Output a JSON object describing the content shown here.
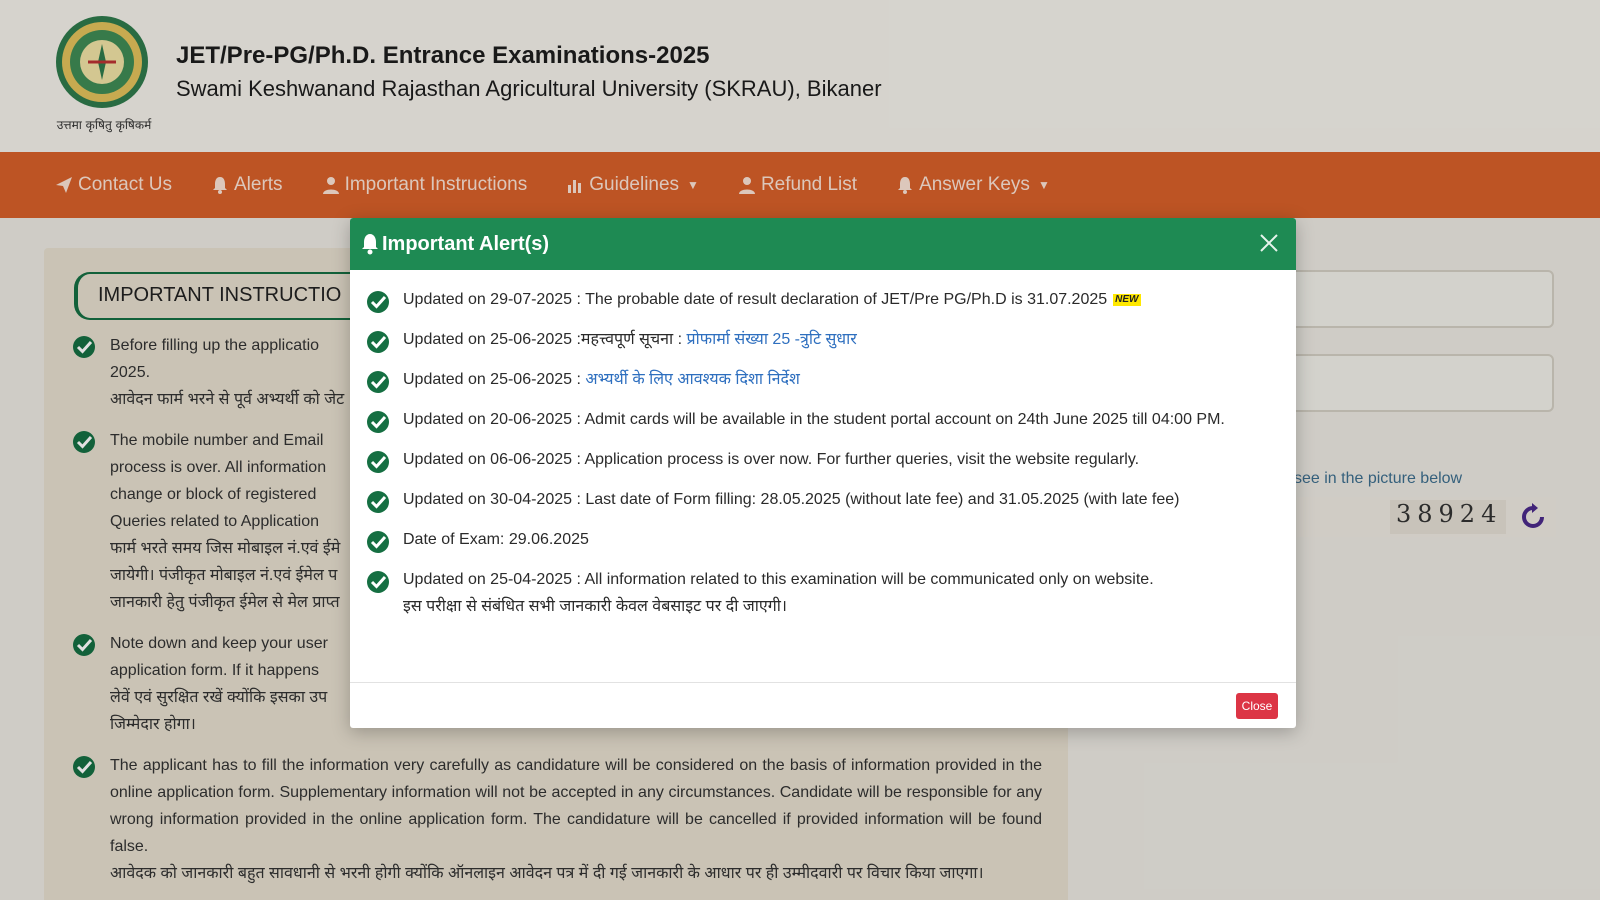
{
  "header": {
    "title": "JET/Pre-PG/Ph.D. Entrance Examinations-2025",
    "subtitle": "Swami Keshwanand Rajasthan Agricultural University (SKRAU), Bikaner",
    "logo_motto": "उत्तमा कृषितु कृषिकर्म"
  },
  "nav": {
    "items": [
      {
        "label": "Contact Us",
        "icon": "paper-plane-icon"
      },
      {
        "label": "Alerts",
        "icon": "bell-icon"
      },
      {
        "label": "Important Instructions",
        "icon": "user-icon"
      },
      {
        "label": "Guidelines",
        "icon": "bar-chart-icon",
        "dropdown": true
      },
      {
        "label": "Refund List",
        "icon": "user-icon"
      },
      {
        "label": "Answer Keys",
        "icon": "bell-icon",
        "dropdown": true
      }
    ]
  },
  "background": {
    "instructions_title": "IMPORTANT INSTRUCTIO",
    "items": [
      {
        "lines": [
          "Before filling up the applicatio",
          "2025.",
          "आवेदन फार्म भरने से पूर्व अभ्यर्थी को जेट"
        ]
      },
      {
        "lines": [
          "The mobile number and Email",
          "process is over. All information",
          "change or block of registered",
          "Queries related to Application",
          "फार्म भरते समय जिस मोबाइल नं.एवं ईमे",
          "जायेगी। पंजीकृत मोबाइल नं.एवं ईमेल प",
          "जानकारी हेतु पंजीकृत ईमेल से मेल प्राप्त"
        ]
      },
      {
        "lines": [
          "Note down and keep your user",
          "application form. If it happens",
          "लेवें एवं सुरक्षित रखें क्योंकि इसका उप",
          "जिम्मेदार होगा।"
        ]
      },
      {
        "text": "The applicant has to fill the information very carefully as candidature will be considered on the basis of information provided in the online application form. Supplementary information will not be accepted in any circumstances. Candidate will be responsible for any wrong information provided in the online application form. The candidature will be cancelled if provided information will be found false.",
        "hindi": "आवेदक को जानकारी बहुत सावधानी से भरनी होगी क्योंकि ऑनलाइन आवेदन पत्र में दी गई जानकारी के आधार पर ही उम्मीदवारी पर विचार किया जाएगा।"
      }
    ],
    "captcha_hint": "see in the picture below",
    "captcha_value": "38924"
  },
  "modal": {
    "title": "Important Alert(s)",
    "close_label": "Close",
    "new_badge": "NEW",
    "alerts": [
      {
        "text": "Updated on 29-07-2025 : The probable date of result declaration of JET/Pre PG/Ph.D is 31.07.2025"
      },
      {
        "text": "Updated on 25-06-2025 :महत्त्वपूर्ण सूचना : ",
        "link": "प्रोफार्मा संख्या 25 -त्रुटि सुधार"
      },
      {
        "text": "Updated on 25-06-2025 : ",
        "link": "अभ्यर्थी के लिए आवश्यक दिशा निर्देश"
      },
      {
        "text": "Updated on 20-06-2025 : Admit cards will be available in the student portal account on 24th June 2025 till 04:00 PM."
      },
      {
        "text": "Updated on 06-06-2025 : Application process is over now. For further queries, visit the website regularly."
      },
      {
        "text": "Updated on 30-04-2025 : Last date of Form filling: 28.05.2025 (without late fee) and 31.05.2025 (with late fee)"
      },
      {
        "text": "Date of Exam: 29.06.2025"
      },
      {
        "text": "Updated on 25-04-2025 : All information related to this examination will be communicated only on website.",
        "hindi": "इस परीक्षा से संबंधित सभी जानकारी केवल वेबसाइट पर दी जाएगी।"
      }
    ]
  },
  "colors": {
    "nav_bg": "#d8602a",
    "modal_header": "#1e8a53",
    "check_green": "#156f42",
    "link_blue": "#2e6fbf",
    "close_red": "#dc3545"
  }
}
